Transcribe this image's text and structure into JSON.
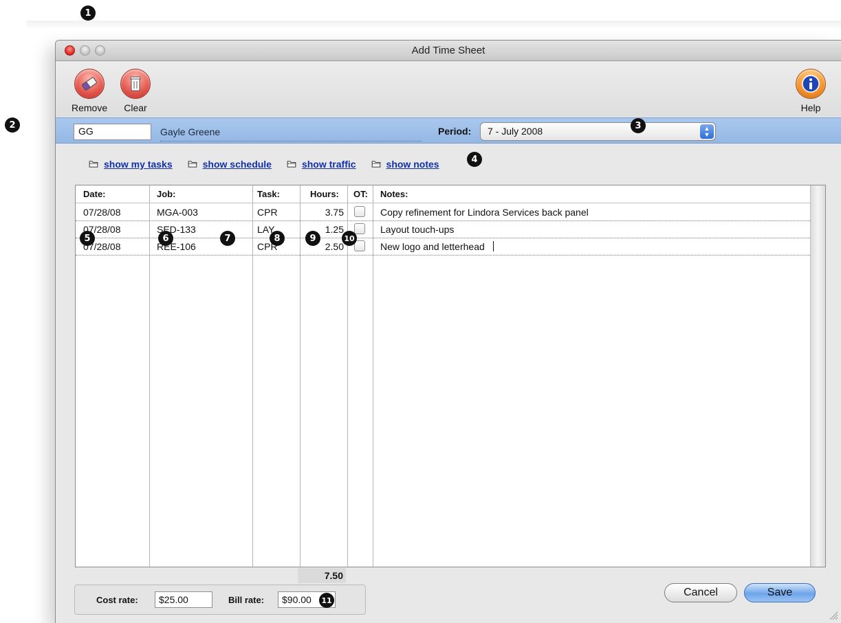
{
  "window": {
    "title": "Add Time Sheet"
  },
  "toolbar": {
    "remove_label": "Remove",
    "clear_label": "Clear",
    "help_label": "Help"
  },
  "employee": {
    "initials": "GG",
    "name": "Gayle Greene"
  },
  "period": {
    "label": "Period:",
    "value": "7 - July 2008"
  },
  "links": {
    "show_my_tasks": "show my tasks",
    "show_schedule": "show schedule",
    "show_traffic": "show traffic",
    "show_notes": "show notes"
  },
  "table": {
    "headers": {
      "date": "Date:",
      "job": "Job:",
      "task": "Task:",
      "hours": "Hours:",
      "ot": "OT:",
      "notes": "Notes:"
    },
    "rows": [
      {
        "date": "07/28/08",
        "job": "MGA-003",
        "task": "CPR",
        "hours": "3.75",
        "ot": false,
        "notes": "Copy refinement for Lindora Services back panel"
      },
      {
        "date": "07/28/08",
        "job": "SED-133",
        "task": "LAY",
        "hours": "1.25",
        "ot": false,
        "notes": "Layout touch-ups"
      },
      {
        "date": "07/28/08",
        "job": "REE-106",
        "task": "CPR",
        "hours": "2.50",
        "ot": false,
        "notes": "New logo and letterhead"
      }
    ],
    "total_hours": "7.50"
  },
  "rates": {
    "cost_label": "Cost rate:",
    "cost_value": "$25.00",
    "bill_label": "Bill rate:",
    "bill_value": "$90.00"
  },
  "buttons": {
    "cancel": "Cancel",
    "save": "Save"
  },
  "callouts": [
    "1",
    "2",
    "3",
    "4",
    "5",
    "6",
    "7",
    "8",
    "9",
    "10",
    "11"
  ],
  "colors": {
    "header_bar": "#9dbde9",
    "link": "#1230a6",
    "save_button": "#6ea5ea",
    "close_button": "#d8231d"
  },
  "icons": {
    "remove": "eraser-icon",
    "clear": "trash-icon",
    "help": "info-icon",
    "links": "folder-icon"
  }
}
